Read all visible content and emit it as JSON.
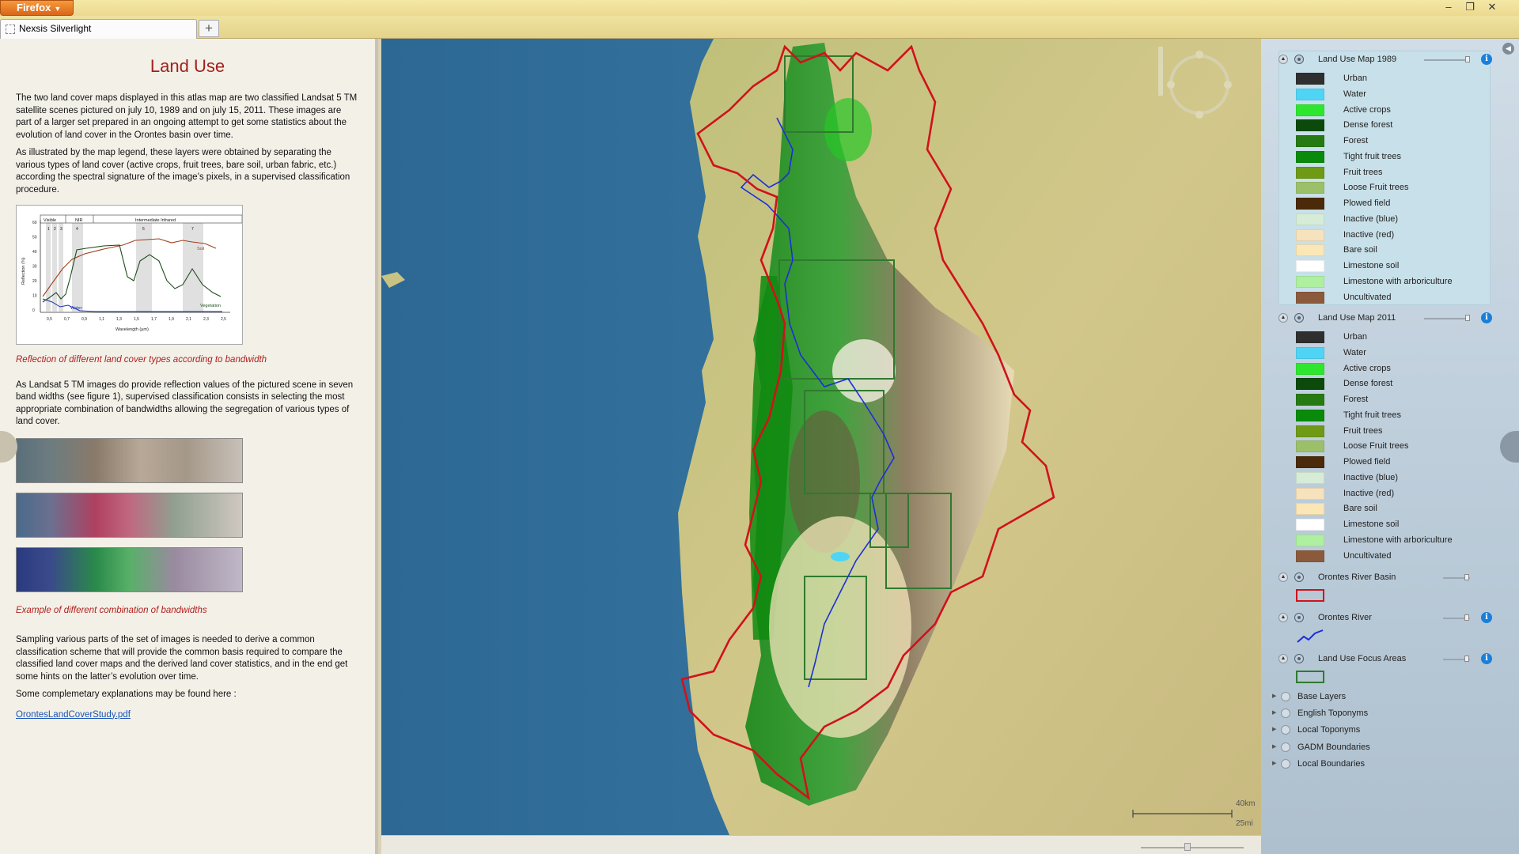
{
  "browser": {
    "menu_label": "Firefox",
    "tab_title": "Nexsis Silverlight",
    "new_tab_label": "+",
    "window_controls": [
      "–",
      "❐",
      "✕"
    ]
  },
  "article": {
    "title": "Land Use",
    "p1": "The two land cover maps displayed in this atlas map are two classified Landsat 5 TM satellite scenes pictured on july 10, 1989 and on july 15, 2011. These images are part of a larger set prepared in an ongoing attempt to get some statistics about the evolution of land cover in the Orontes basin over time.",
    "p2": "As illustrated by the map legend, these layers were obtained by separating the various types of land cover (active crops, fruit trees, bare soil, urban fabric, etc.) according the spectral signature of the image’s pixels, in a supervised classification procedure.",
    "figure1": {
      "bands_top": [
        "Visible",
        "NIR",
        "Intermediate Infrared"
      ],
      "band_numbers": [
        "1",
        "2",
        "3",
        "4",
        "5",
        "7"
      ],
      "ylabel": "Reflection (%)",
      "xlabel": "Wavelength (µm)",
      "y_ticks": [
        "60",
        "50",
        "40",
        "30",
        "20",
        "10",
        "0"
      ],
      "x_ticks": [
        "0,5",
        "0,7",
        "0,9",
        "1,1",
        "1,3",
        "1,5",
        "1,7",
        "1,9",
        "2,1",
        "2,3",
        "2,5"
      ],
      "curve_labels": [
        "Soil",
        "Water",
        "Vegetation"
      ]
    },
    "caption1": "Reflection of different land cover types according to bandwidth",
    "p3": "As Landsat 5 TM images do provide reflection values of the pictured scene in seven band widths (see figure 1), supervised classification consists in selecting the most appropriate combination of bandwidths allowing the segregation of various types of land cover.",
    "caption2": "Example of different combination of bandwidths",
    "p4": "Sampling various parts of the set of images is needed to derive a common classification scheme that will provide the common basis required to compare the classified land cover maps and the derived land cover statistics, and in the end get some hints on the latter’s evolution over time.",
    "p5": "Some complemetary explanations may be found here :",
    "link": "OrontesLandCoverStudy.pdf"
  },
  "map": {
    "scale_km": "40km",
    "scale_mi": "25mi"
  },
  "legend": {
    "layers": [
      {
        "title": "Land Use Map 1989",
        "classes": [
          {
            "label": "Urban",
            "color": "#2f2f2f"
          },
          {
            "label": "Water",
            "color": "#4fd4f5"
          },
          {
            "label": "Active crops",
            "color": "#2ee62e"
          },
          {
            "label": "Dense forest",
            "color": "#0b4a0b"
          },
          {
            "label": "Forest",
            "color": "#267a12"
          },
          {
            "label": "Tight fruit trees",
            "color": "#0a8a0a"
          },
          {
            "label": "Fruit trees",
            "color": "#6f9a16"
          },
          {
            "label": "Loose Fruit trees",
            "color": "#9cc06a"
          },
          {
            "label": "Plowed field",
            "color": "#4a2a08"
          },
          {
            "label": "Inactive (blue)",
            "color": "#d6ecd6"
          },
          {
            "label": "Inactive (red)",
            "color": "#f6e2bd"
          },
          {
            "label": "Bare soil",
            "color": "#fbe7b5"
          },
          {
            "label": "Limestone soil",
            "color": "#ffffff"
          },
          {
            "label": "Limestone with arboriculture",
            "color": "#aef0a0"
          },
          {
            "label": "Uncultivated",
            "color": "#8b5a3c"
          }
        ]
      },
      {
        "title": "Land Use Map 2011",
        "classes": [
          {
            "label": "Urban",
            "color": "#2f2f2f"
          },
          {
            "label": "Water",
            "color": "#4fd4f5"
          },
          {
            "label": "Active crops",
            "color": "#2ee62e"
          },
          {
            "label": "Dense forest",
            "color": "#0b4a0b"
          },
          {
            "label": "Forest",
            "color": "#267a12"
          },
          {
            "label": "Tight fruit trees",
            "color": "#0a8a0a"
          },
          {
            "label": "Fruit trees",
            "color": "#6f9a16"
          },
          {
            "label": "Loose Fruit trees",
            "color": "#9cc06a"
          },
          {
            "label": "Plowed field",
            "color": "#4a2a08"
          },
          {
            "label": "Inactive (blue)",
            "color": "#d6ecd6"
          },
          {
            "label": "Inactive (red)",
            "color": "#f6e2bd"
          },
          {
            "label": "Bare soil",
            "color": "#fbe7b5"
          },
          {
            "label": "Limestone soil",
            "color": "#ffffff"
          },
          {
            "label": "Limestone with arboriculture",
            "color": "#aef0a0"
          },
          {
            "label": "Uncultivated",
            "color": "#8b5a3c"
          }
        ]
      }
    ],
    "overlays": [
      {
        "title": "Orontes River Basin",
        "color": "#d0121b"
      },
      {
        "title": "Orontes River",
        "color": "#1c2fd6"
      },
      {
        "title": "Land Use Focus Areas",
        "color": "#2f7a2f"
      }
    ],
    "groups": [
      "Base Layers",
      "English Toponyms",
      "Local Toponyms",
      "GADM Boundaries",
      "Local Boundaries"
    ]
  }
}
